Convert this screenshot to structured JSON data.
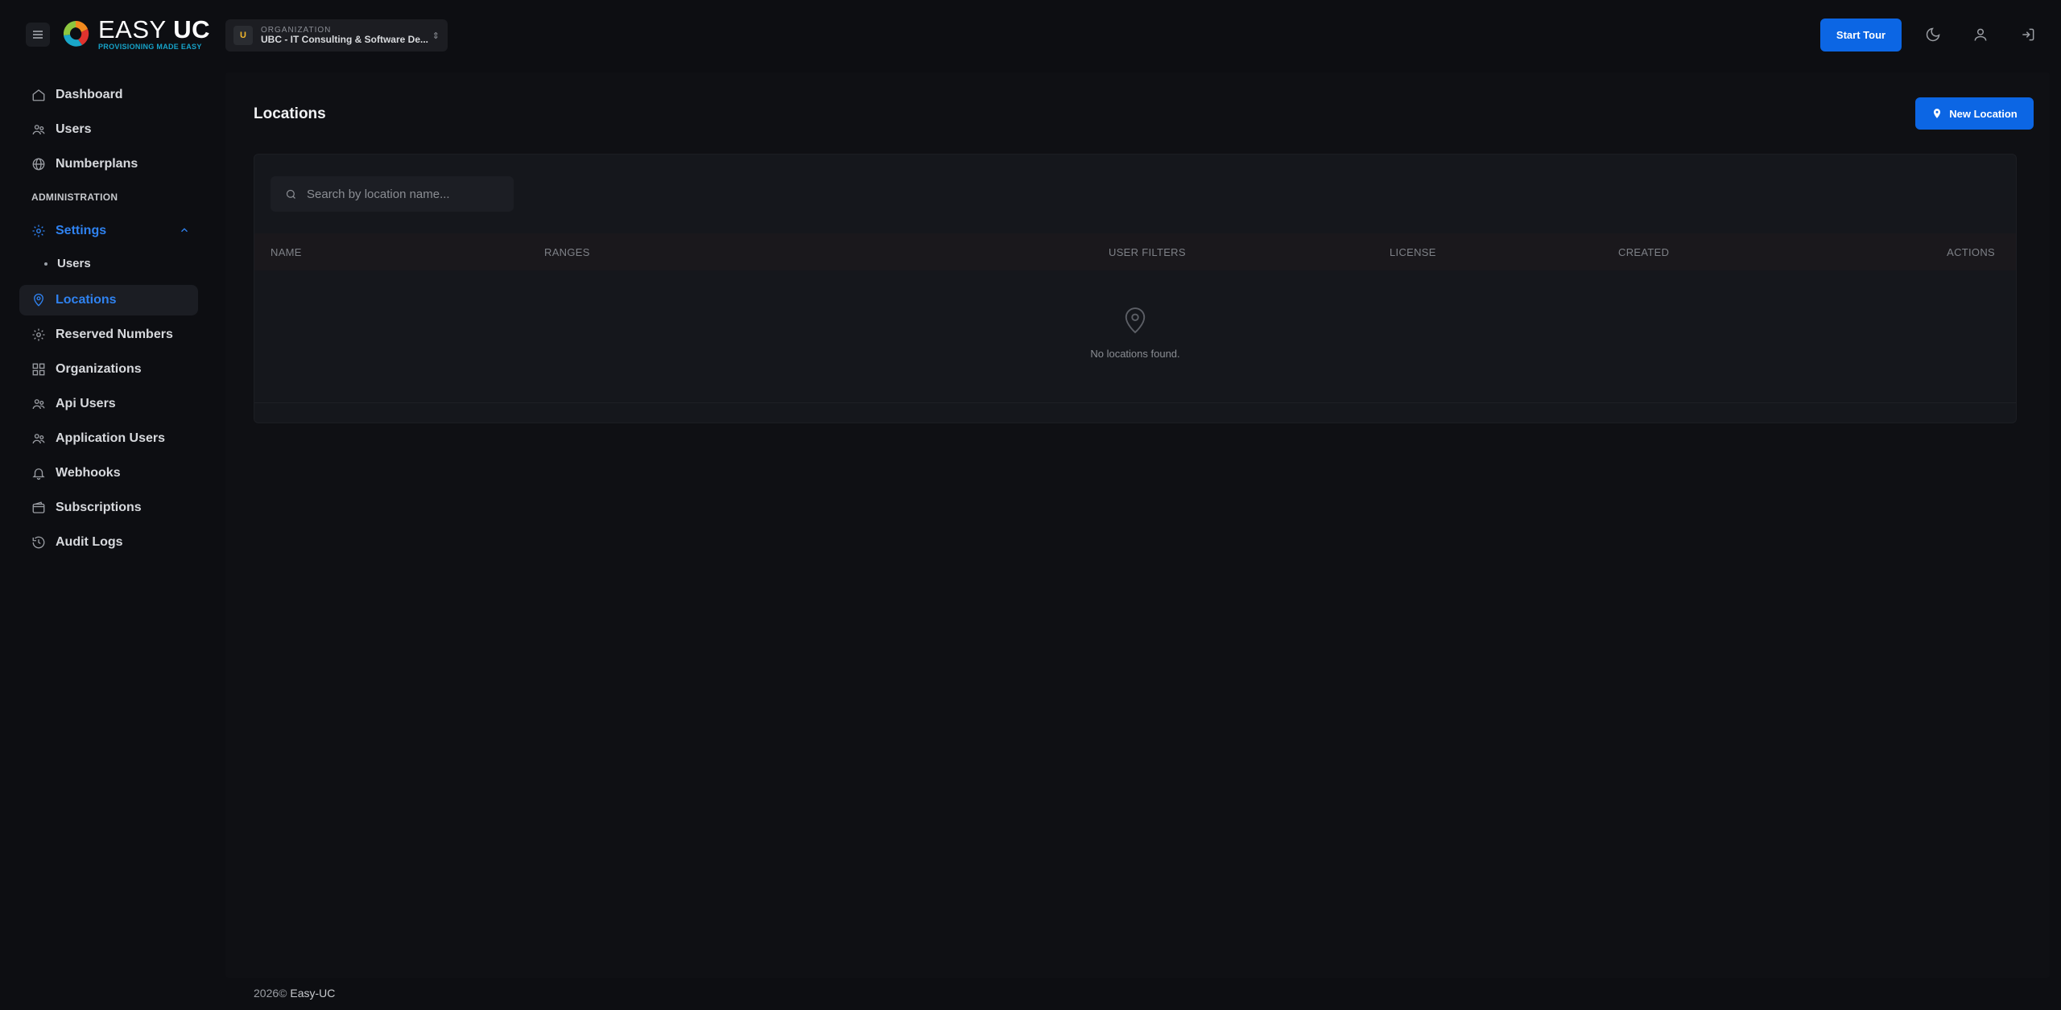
{
  "header": {
    "logo": {
      "title_light": "EASY ",
      "title_bold": "UC",
      "tagline": "PROVISIONING MADE EASY"
    },
    "org_switcher": {
      "avatar_letter": "U",
      "label": "ORGANIZATION",
      "name": "UBC - IT Consulting & Software De..."
    },
    "start_tour_label": "Start Tour",
    "icons": [
      "menu-icon",
      "moon-icon",
      "user-icon",
      "logout-icon"
    ]
  },
  "sidebar": {
    "items": [
      {
        "label": "Dashboard",
        "icon": "home-icon"
      },
      {
        "label": "Users",
        "icon": "users-icon"
      },
      {
        "label": "Numberplans",
        "icon": "globe-icon"
      }
    ],
    "section_label": "ADMINISTRATION",
    "settings": {
      "label": "Settings",
      "icon": "gear-icon",
      "expanded": true,
      "sub_items": [
        {
          "label": "Users"
        }
      ]
    },
    "admin_items": [
      {
        "label": "Locations",
        "icon": "location-icon",
        "active": true
      },
      {
        "label": "Reserved Numbers",
        "icon": "gear-icon"
      },
      {
        "label": "Organizations",
        "icon": "grid-icon"
      },
      {
        "label": "Api Users",
        "icon": "users-icon"
      },
      {
        "label": "Application Users",
        "icon": "users-icon"
      },
      {
        "label": "Webhooks",
        "icon": "bell-icon"
      },
      {
        "label": "Subscriptions",
        "icon": "wallet-icon"
      },
      {
        "label": "Audit Logs",
        "icon": "history-icon"
      }
    ]
  },
  "main": {
    "title": "Locations",
    "new_button_label": "New Location",
    "search": {
      "placeholder": "Search by location name...",
      "value": ""
    },
    "table": {
      "columns": [
        "NAME",
        "RANGES",
        "USER FILTERS",
        "LICENSE",
        "CREATED",
        "ACTIONS"
      ],
      "rows": [],
      "empty_text": "No locations found."
    }
  },
  "footer": {
    "year": "2026©",
    "brand": "Easy-UC"
  },
  "colors": {
    "accent": "#0c66e4",
    "active_text": "#2f82f0",
    "background": "#0d0e12"
  }
}
